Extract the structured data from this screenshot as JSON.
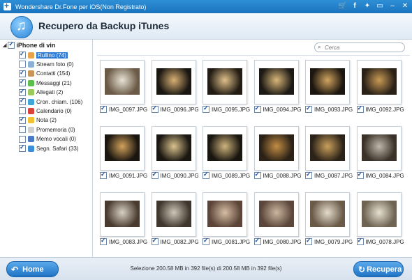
{
  "titlebar": {
    "title": "Wondershare Dr.Fone per iOS(Non Registrato)",
    "icons": [
      "cart-icon",
      "facebook-icon",
      "twitter-icon",
      "chat-icon",
      "minimize-icon",
      "close-icon"
    ]
  },
  "header": {
    "title": "Recupero da Backup iTunes",
    "logo_icon": "itunes-music-icon"
  },
  "sidebar": {
    "root": "iPhone di vin",
    "items": [
      {
        "label": "Rullino (74)",
        "checked": true,
        "selected": true,
        "icon": "camera-roll-icon",
        "color": "#e9a44a"
      },
      {
        "label": "Stream foto (0)",
        "checked": false,
        "icon": "photo-stream-icon",
        "color": "#8ab0d6"
      },
      {
        "label": "Contatti (154)",
        "checked": true,
        "icon": "contacts-icon",
        "color": "#c8945a"
      },
      {
        "label": "Messaggi (21)",
        "checked": true,
        "icon": "messages-icon",
        "color": "#5bbf4c"
      },
      {
        "label": "Allegati (2)",
        "checked": true,
        "icon": "attachment-icon",
        "color": "#9acb5a"
      },
      {
        "label": "Cron. chiam. (106)",
        "checked": true,
        "icon": "call-history-icon",
        "color": "#3ea6d9"
      },
      {
        "label": "Calendario (0)",
        "checked": false,
        "icon": "calendar-icon",
        "color": "#d8443a"
      },
      {
        "label": "Nota (2)",
        "checked": true,
        "icon": "notes-icon",
        "color": "#f2c230"
      },
      {
        "label": "Promemoria (0)",
        "checked": false,
        "icon": "reminders-icon",
        "color": "#cfcfcf"
      },
      {
        "label": "Memo vocali (0)",
        "checked": false,
        "icon": "voice-memo-icon",
        "color": "#4a79c8"
      },
      {
        "label": "Segn. Safari (33)",
        "checked": true,
        "icon": "safari-bookmark-icon",
        "color": "#3a8fd8"
      }
    ]
  },
  "search": {
    "placeholder": "Cerca",
    "icon": "search-icon"
  },
  "photos": [
    {
      "name": "IMG_0097.JPG",
      "checked": true,
      "tone": [
        "#6b5a45",
        "#e8e3d6"
      ]
    },
    {
      "name": "IMG_0096.JPG",
      "checked": true,
      "tone": [
        "#1a1712",
        "#d8b073"
      ]
    },
    {
      "name": "IMG_0095.JPG",
      "checked": true,
      "tone": [
        "#221c14",
        "#e0c08a"
      ]
    },
    {
      "name": "IMG_0094.JPG",
      "checked": true,
      "tone": [
        "#1d1a15",
        "#d9b679"
      ]
    },
    {
      "name": "IMG_0093.JPG",
      "checked": true,
      "tone": [
        "#1b160f",
        "#d2a45f"
      ]
    },
    {
      "name": "IMG_0092.JPG",
      "checked": true,
      "tone": [
        "#2a2117",
        "#c99a55"
      ]
    },
    {
      "name": "IMG_0091.JPG",
      "checked": true,
      "tone": [
        "#1a150f",
        "#d2a25c"
      ]
    },
    {
      "name": "IMG_0090.JPG",
      "checked": true,
      "tone": [
        "#1a1611",
        "#d9c28c"
      ]
    },
    {
      "name": "IMG_0089.JPG",
      "checked": true,
      "tone": [
        "#19150f",
        "#cfb47c"
      ]
    },
    {
      "name": "IMG_0088.JPG",
      "checked": true,
      "tone": [
        "#2b2116",
        "#c28d44"
      ]
    },
    {
      "name": "IMG_0087.JPG",
      "checked": true,
      "tone": [
        "#2c2318",
        "#caa05c"
      ]
    },
    {
      "name": "IMG_0084.JPG",
      "checked": true,
      "tone": [
        "#3a3128",
        "#bfb7aa"
      ]
    },
    {
      "name": "IMG_0083.JPG",
      "checked": true,
      "tone": [
        "#4a3b30",
        "#d8d0c4"
      ]
    },
    {
      "name": "IMG_0082.JPG",
      "checked": true,
      "tone": [
        "#3f362d",
        "#cfc6b8"
      ]
    },
    {
      "name": "IMG_0081.JPG",
      "checked": true,
      "tone": [
        "#5c4538",
        "#d6bda5"
      ]
    },
    {
      "name": "IMG_0080.JPG",
      "checked": true,
      "tone": [
        "#5a463a",
        "#cdb6a0"
      ]
    },
    {
      "name": "IMG_0079.JPG",
      "checked": true,
      "tone": [
        "#6a5a48",
        "#e4dccb"
      ]
    },
    {
      "name": "IMG_0078.JPG",
      "checked": true,
      "tone": [
        "#6f6452",
        "#e6e0d2"
      ]
    }
  ],
  "footer": {
    "home_label": "Home",
    "home_icon": "back-arrow-icon",
    "recover_label": "Recupera",
    "recover_icon": "recover-arrow-icon",
    "status": "Selezione 200.58 MB in 392 file(s) di 200.58 MB in 392 file(s)"
  }
}
